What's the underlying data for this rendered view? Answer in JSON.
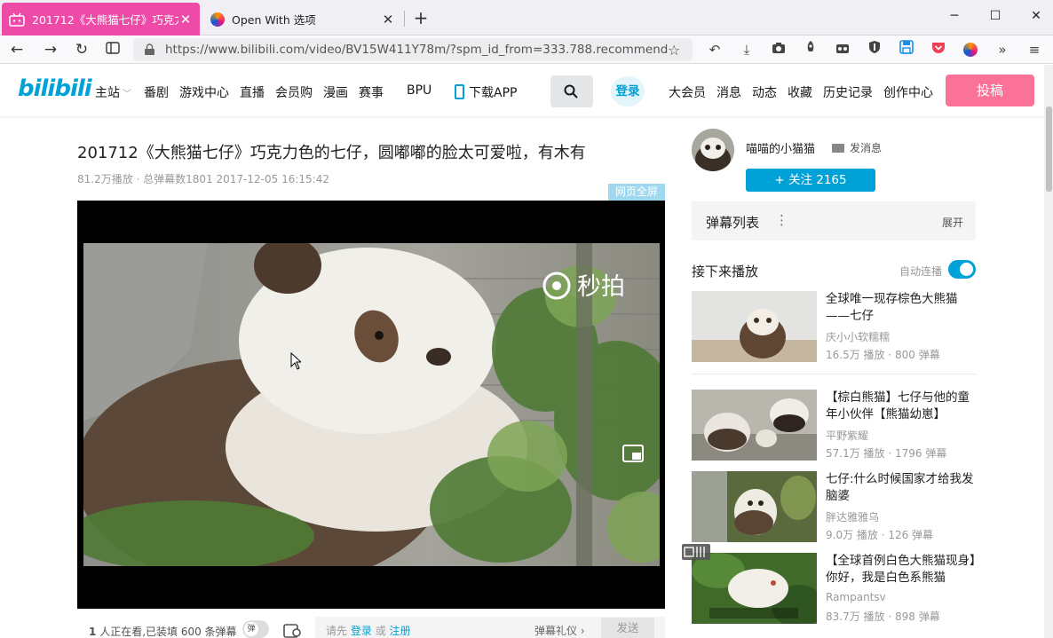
{
  "browser": {
    "tabs": [
      {
        "title": "201712《大熊猫七仔》巧克力",
        "active": true
      },
      {
        "title": "Open With 选项",
        "active": false
      }
    ],
    "url": "https://www.bilibili.com/video/BV15W411Y78m/?spm_id_from=333.788.recommend_more",
    "toolbar_icons": [
      "undo-icon",
      "download-icon",
      "camera-icon",
      "rocket-icon",
      "extension-icon",
      "shield-icon",
      "save-icon",
      "pocket-icon",
      "firefox-icon",
      "overflow-icon",
      "menu-icon"
    ]
  },
  "site": {
    "logo": "bilibili",
    "nav": [
      "主站",
      "番剧",
      "游戏中心",
      "直播",
      "会员购",
      "漫画",
      "赛事",
      "BPU",
      "下载APP"
    ],
    "login": "登录",
    "user_nav": [
      "大会员",
      "消息",
      "动态",
      "收藏",
      "历史记录",
      "创作中心"
    ],
    "post": "投稿"
  },
  "video": {
    "title": "201712《大熊猫七仔》巧克力色的七仔，圆嘟嘟的脸太可爱啦，有木有",
    "meta": "81.2万播放 · 总弹幕数1801    2017-12-05 16:15:42",
    "web_fullscreen": "网页全屏",
    "watermark": "秒拍",
    "danmaku_bar": {
      "watching": "1",
      "watching_text": "人正在看,已装填 600 条弹幕",
      "toggle": "弹",
      "prompt": "请先",
      "login": "登录",
      "or": "或",
      "register": "注册",
      "etiquette": "弹幕礼仪",
      "send": "发送"
    }
  },
  "uploader": {
    "name": "喵喵的小猫猫",
    "message": "发消息",
    "follow": "+ 关注 2165"
  },
  "danmaku_list": {
    "label": "弹幕列表",
    "expand": "展开"
  },
  "up_next": {
    "label": "接下来播放",
    "autoplay": "自动连播"
  },
  "recommendations": [
    {
      "title": "全球唯一现存棕色大熊猫——七仔",
      "up": "庆小小软糯糯",
      "stats": "16.5万 播放 · 800 弹幕"
    },
    {
      "title": "【棕白熊猫】七仔与他的童年小伙伴【熊猫幼崽】",
      "up": "平野紫耀",
      "stats": "57.1万 播放 · 1796 弹幕"
    },
    {
      "title": "七仔:什么时候国家才给我发脑婆",
      "up": "胖达雅雅乌",
      "stats": "9.0万 播放 · 126 弹幕"
    },
    {
      "title": "【全球首例白色大熊猫现身】你好，我是白色系熊猫",
      "up": "Rampantsv",
      "stats": "83.7万 播放 · 898 弹幕"
    }
  ],
  "colors": {
    "brand": "#00a1d6",
    "pink": "#fb7299",
    "tab_active": "#ee4aa8"
  }
}
